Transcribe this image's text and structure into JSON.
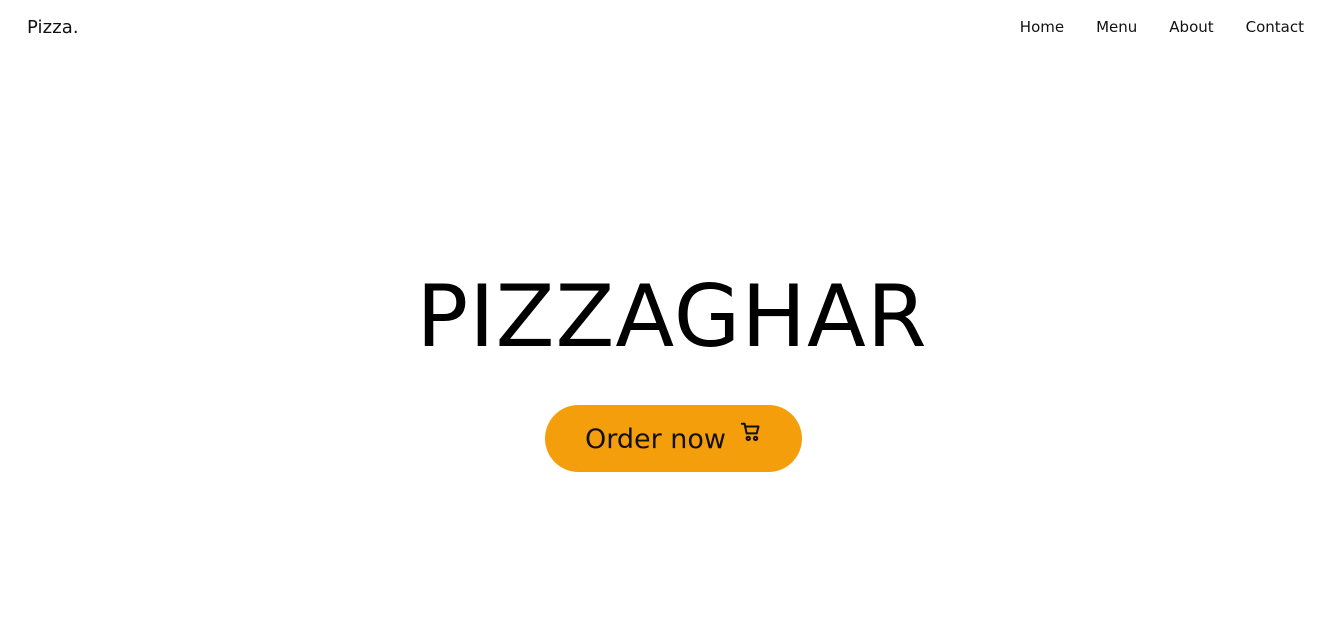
{
  "brand": {
    "name": "Pizza."
  },
  "nav": {
    "items": [
      {
        "label": "Home"
      },
      {
        "label": "Menu"
      },
      {
        "label": "About"
      },
      {
        "label": "Contact"
      }
    ]
  },
  "hero": {
    "title": "PIZZAGHAR",
    "cta": {
      "label": "Order now",
      "icon": "cart-icon",
      "background": "#f59e0b"
    }
  }
}
